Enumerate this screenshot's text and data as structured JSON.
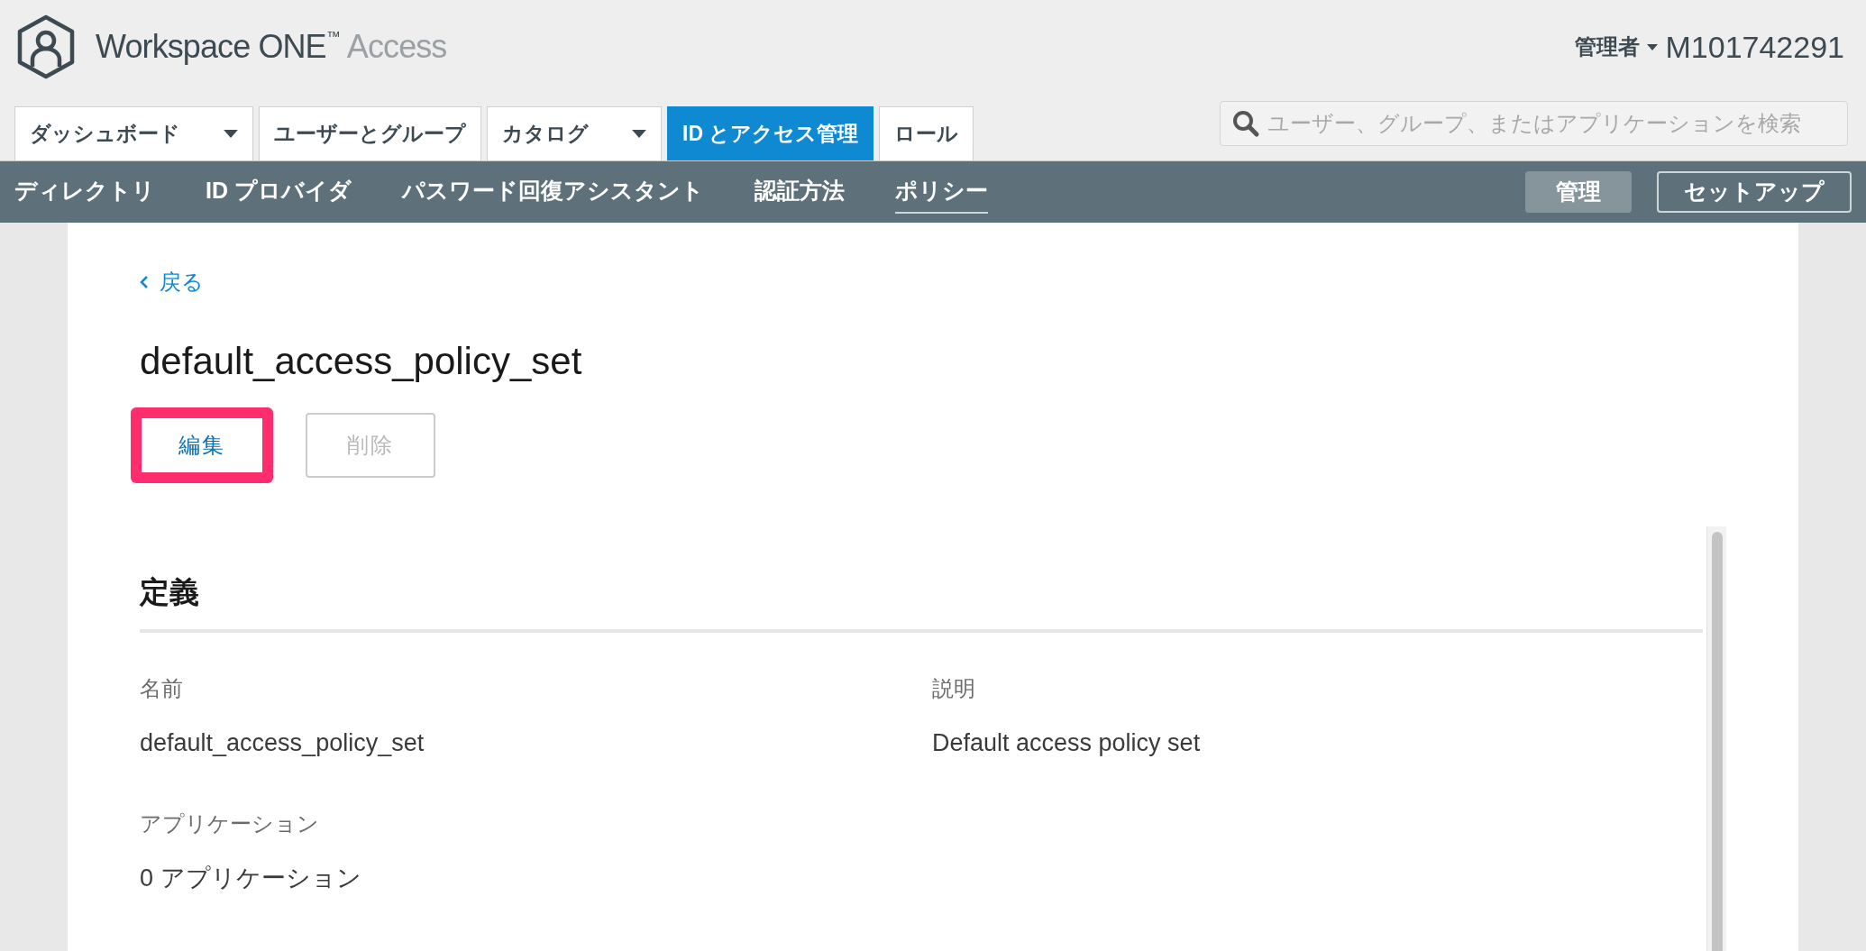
{
  "header": {
    "logo_text": "Workspace ONE",
    "logo_tm": "™",
    "logo_suffix": "Access",
    "role": "管理者",
    "user": "M101742291"
  },
  "tabs": [
    {
      "label": "ダッシュボード",
      "dropdown": true,
      "selected": false
    },
    {
      "label": "ユーザーとグループ",
      "dropdown": false,
      "selected": false
    },
    {
      "label": "カタログ",
      "dropdown": true,
      "selected": false
    },
    {
      "label": "ID とアクセス管理",
      "dropdown": false,
      "selected": true
    },
    {
      "label": "ロール",
      "dropdown": false,
      "selected": false
    }
  ],
  "search": {
    "placeholder": "ユーザー、グループ、またはアプリケーションを検索"
  },
  "subnav": [
    {
      "label": "ディレクトリ",
      "selected": false
    },
    {
      "label": "ID プロバイダ",
      "selected": false
    },
    {
      "label": "パスワード回復アシスタント",
      "selected": false
    },
    {
      "label": "認証方法",
      "selected": false
    },
    {
      "label": "ポリシー",
      "selected": true
    }
  ],
  "mode_buttons": [
    {
      "label": "管理",
      "selected": true
    },
    {
      "label": "セットアップ",
      "selected": false
    }
  ],
  "back_link": "戻る",
  "title": "default_access_policy_set",
  "actions": [
    {
      "label": "編集",
      "disabled": false,
      "highlighted": true
    },
    {
      "label": "削除",
      "disabled": true,
      "highlighted": false
    }
  ],
  "section": {
    "heading": "定義",
    "fields": [
      {
        "label": "名前",
        "value": "default_access_policy_set"
      },
      {
        "label": "説明",
        "value": "Default access policy set"
      },
      {
        "label": "アプリケーション",
        "value": "0 アプリケーション"
      }
    ]
  }
}
